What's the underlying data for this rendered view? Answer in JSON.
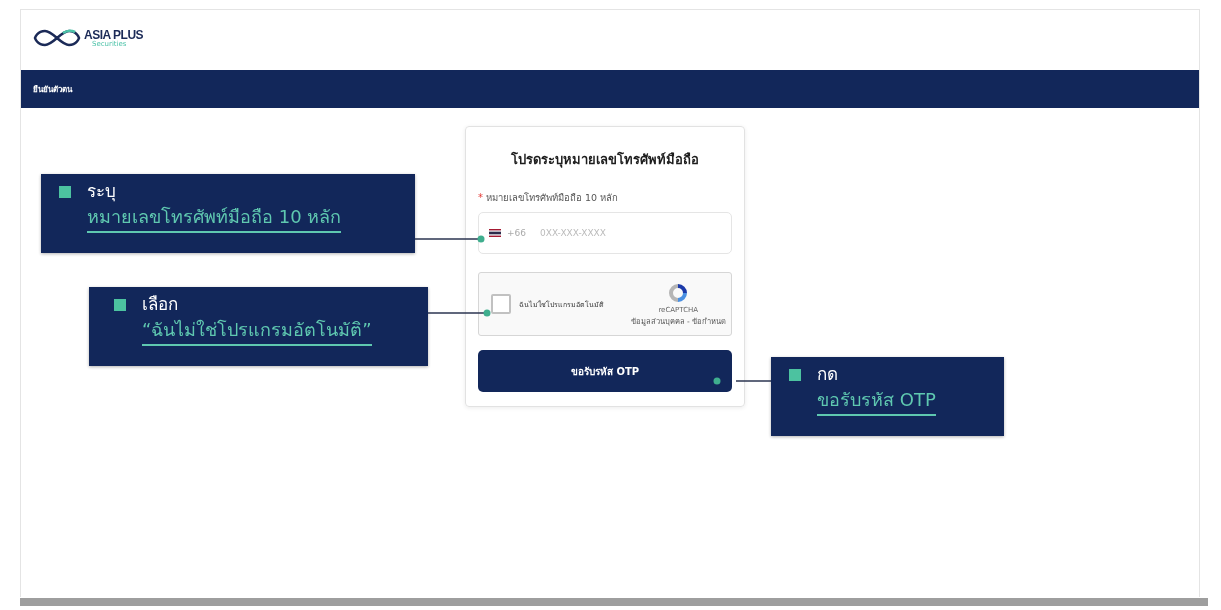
{
  "logo": {
    "name": "ASIA PLUS",
    "tagline": "Securities"
  },
  "nav": {
    "title": "ยืนยันตัวตน"
  },
  "form": {
    "title": "โปรดระบุหมายเลขโทรศัพท์มือถือ",
    "phone_label": {
      "marker": "*",
      "text": "หมายเลขโทรศัพท์มือถือ 10 หลัก"
    },
    "phone_field": {
      "prefix": "+66",
      "placeholder": "0XX-XXX-XXXX"
    },
    "captcha": {
      "label": "ฉันไม่ใช่โปรแกรมอัตโนมัติ",
      "checked": false,
      "brand": "reCAPTCHA",
      "links": "ข้อมูลส่วนบุคคล - ข้อกำหนด"
    },
    "submit": "ขอรับรหัส OTP"
  },
  "callouts": [
    {
      "verb": "ระบุ",
      "target": "หมายเลขโทรศัพท์มือถือ 10 หลัก"
    },
    {
      "verb": "เลือก",
      "target": "“ฉันไม่ใช่โปรแกรมอัตโนมัติ”"
    },
    {
      "verb": "กด",
      "target": "ขอรับรหัส OTP"
    }
  ]
}
